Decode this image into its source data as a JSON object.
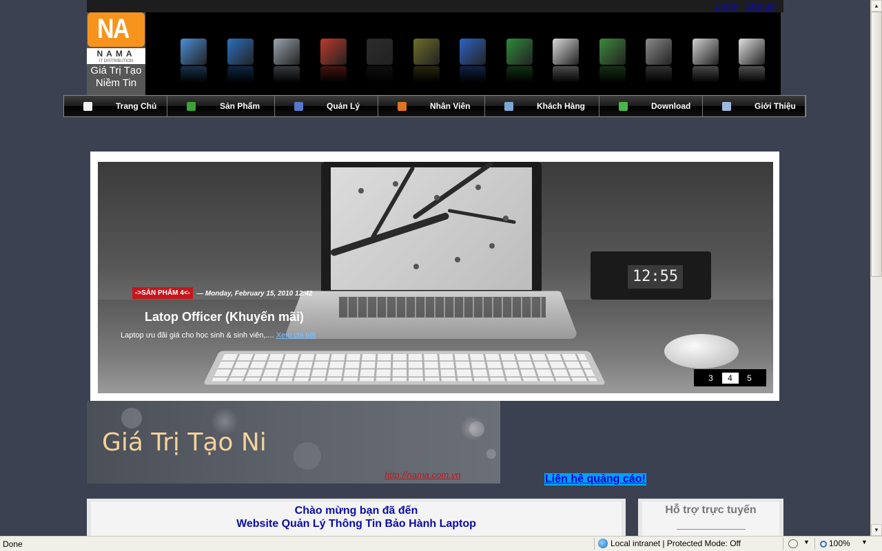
{
  "auth": {
    "login": "Login",
    "signup": "Signup"
  },
  "logo": {
    "mark": "NA",
    "name": "NAMA",
    "sub": "IT DISTRIBUTION",
    "slogan_line1": "Giá Trị Tạo",
    "slogan_line2": "Niềm Tin"
  },
  "product_icons": [
    {
      "name": "desktop-computer-icon",
      "color": "#4a8fd6"
    },
    {
      "name": "laptop-icon",
      "color": "#2c6fbf"
    },
    {
      "name": "hard-drive-icon",
      "color": "#9aa3ad"
    },
    {
      "name": "ram-icon",
      "color": "#c0392b"
    },
    {
      "name": "pc-case-icon",
      "color": "#2b2b2b"
    },
    {
      "name": "mobile-phone-icon",
      "color": "#6e6e2a"
    },
    {
      "name": "wireless-router-icon",
      "color": "#2e64c4"
    },
    {
      "name": "cpu-chip-icon",
      "color": "#2e8b3a"
    },
    {
      "name": "printer-icon",
      "color": "#d9d9d9"
    },
    {
      "name": "motherboard-icon",
      "color": "#3e8a3e"
    },
    {
      "name": "webcam-icon",
      "color": "#8a8a8a"
    },
    {
      "name": "headphones-icon",
      "color": "#d0d0d0"
    },
    {
      "name": "usb-drive-icon",
      "color": "#e0e0e0"
    }
  ],
  "nav": [
    {
      "label": "Trang Chủ",
      "icon": "home-icon",
      "color": "#f2f2f2"
    },
    {
      "label": "Sản Phẩm",
      "icon": "product-icon",
      "color": "#3aa335"
    },
    {
      "label": "Quản Lý",
      "icon": "shield-icon",
      "color": "#5577cc"
    },
    {
      "label": "Nhân Viên",
      "icon": "staff-icon",
      "color": "#e0731e"
    },
    {
      "label": "Khách Hàng",
      "icon": "customer-icon",
      "color": "#7ea6d6"
    },
    {
      "label": "Download",
      "icon": "download-icon",
      "color": "#4ab54a"
    },
    {
      "label": "Giới Thiệu",
      "icon": "about-icon",
      "color": "#9fb8e0"
    }
  ],
  "slide": {
    "category": "->SẢN PHẨM 4<-",
    "date": "— Monday, February 15, 2010 12:42",
    "title": "Latop Officer (Khuyến mãi)",
    "description": "Laptop ưu đãi giá cho học sinh & sinh viên,....",
    "more": "Xem chi tiết",
    "clock": "12:55",
    "pager": [
      "3",
      "4",
      "5"
    ],
    "active_page": "4"
  },
  "banner": {
    "title": "Giá Trị Tạo Ni",
    "url": "http://nama.com.vn"
  },
  "ads_link": "Liên hệ quảng cáo!",
  "welcome": {
    "line1": "Chào mừng bạn đã đến",
    "line2": "Website Quản Lý Thông Tin Bảo Hành Laptop"
  },
  "support": {
    "title": "Hỗ trợ trực tuyến"
  },
  "statusbar": {
    "status": "Done",
    "zone": "Local intranet | Protected Mode: Off",
    "zoom": "100%"
  },
  "scroll": {
    "thumb_fraction": 0.5
  }
}
